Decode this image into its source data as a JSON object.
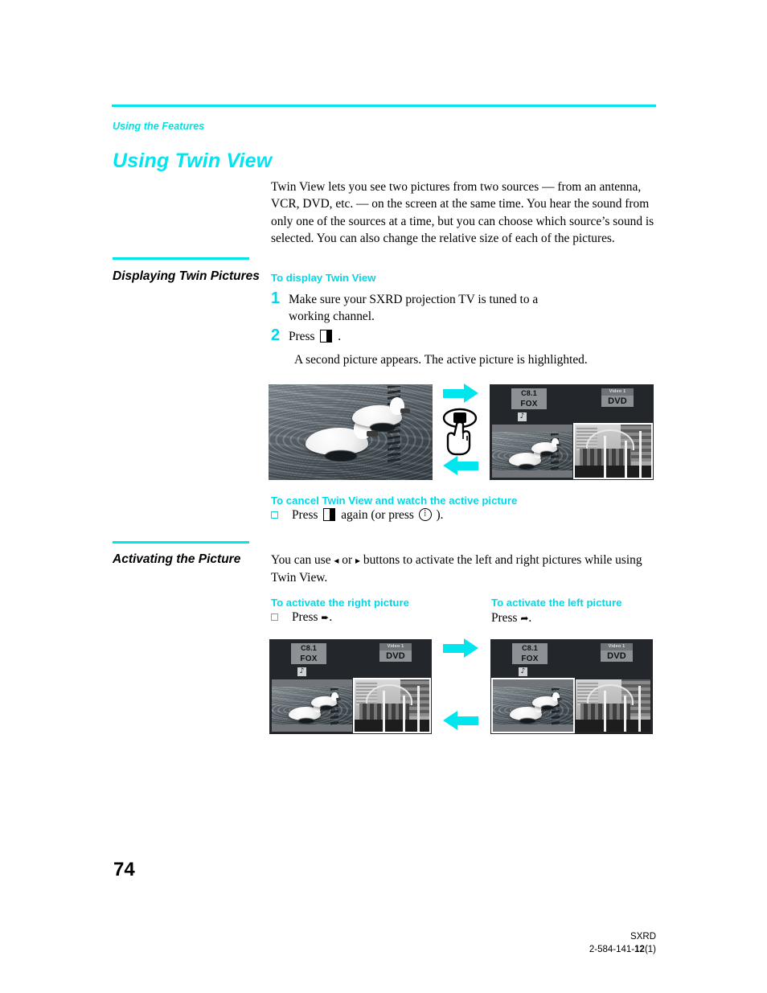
{
  "document": {
    "running_head": "Using the Features",
    "chapter_title": "Using Twin View",
    "page_number": "74",
    "footer_line1": "SXRD",
    "footer_model_prefix": "2-584-141-",
    "footer_model_bold": "12",
    "footer_model_suffix": "(1)"
  },
  "intro": {
    "paragraph": "Twin View lets you see two pictures from two sources — from an antenna, VCR, DVD, etc. — on the screen at the same time. You hear the sound from only one of the sources at a time, but you can choose which source’s sound is selected. You can also change the relative size of each of the pictures."
  },
  "section1": {
    "heading": "Displaying Twin Pictures",
    "subhead": "To display Twin View",
    "steps": [
      {
        "num": "1",
        "text": "Make sure your SXRD projection TV is tuned to a working channel."
      },
      {
        "num": "2",
        "text_before": "Press",
        "text_after": "."
      }
    ],
    "result_text": "A second picture appears. The active picture is highlighted.",
    "cancel_subhead": "To cancel Twin View and watch the active picture",
    "cancel_before": "Press",
    "cancel_middle": "again (or press",
    "cancel_after": ")."
  },
  "section2": {
    "heading": "Activating the Picture",
    "intro_before": "You can use",
    "intro_arrow_left": "◂",
    "intro_or": "or",
    "intro_arrow_right": "▸",
    "intro_after": "buttons to activate the left and right pictures while using Twin View.",
    "right_subhead": "To activate the right picture",
    "right_instruction_before": "Press",
    "right_instruction_arrow": "➨",
    "right_instruction_after": ".",
    "left_subhead": "To activate the left picture",
    "left_instruction_before": "Press",
    "left_instruction_arrow": "➦",
    "left_instruction_after": "."
  },
  "figure1": {
    "caption_photo": "single-picture-photo",
    "arrow_right": "arrow-right",
    "arrow_left": "arrow-left",
    "hand_button": "hand-pressing-twin-view-button",
    "tv": {
      "osd_left_channel": "C8.1",
      "osd_left_network": "FOX",
      "osd_left_note": "♪",
      "osd_right_label": "Video 1",
      "osd_right_source": "DVD",
      "active_pane": "right"
    }
  },
  "figure2": {
    "tv_left": {
      "osd_left_channel": "C8.1",
      "osd_left_network": "FOX",
      "osd_left_note": "♪",
      "osd_right_label": "Video 1",
      "osd_right_source": "DVD",
      "active_pane": "right"
    },
    "tv_right": {
      "osd_left_channel": "C8.1",
      "osd_left_network": "FOX",
      "osd_left_note": "♪",
      "osd_right_label": "Video 1",
      "osd_right_source": "DVD",
      "active_pane": "left"
    }
  },
  "colors": {
    "accent_cyan": "#00e5e5",
    "heading_cyan": "#00d8e8",
    "arrow_cyan": "#00e5ee",
    "tv_bezel": "#23262b"
  }
}
